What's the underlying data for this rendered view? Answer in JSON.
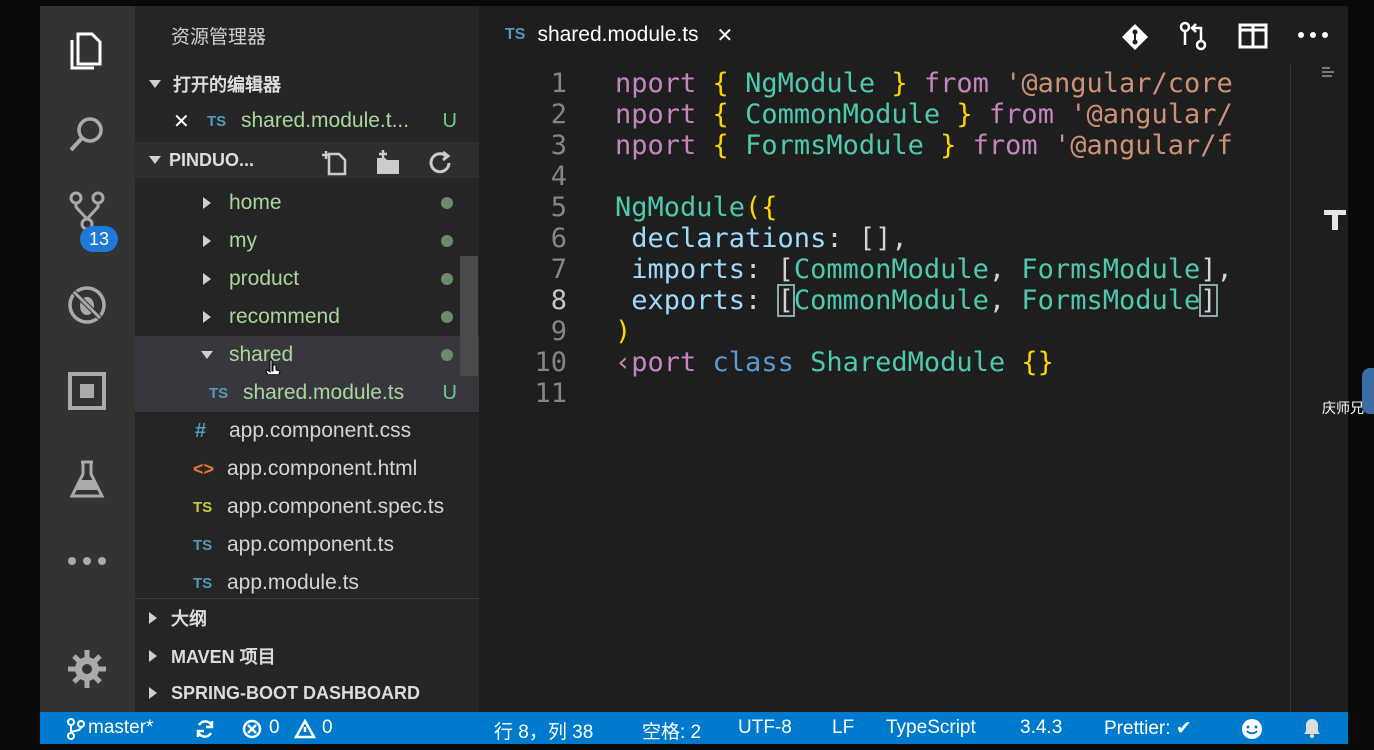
{
  "sidebar": {
    "title": "资源管理器",
    "open_editors_header": "打开的编辑器",
    "open_editor": {
      "badge": "TS",
      "name": "shared.module.t...",
      "status": "U"
    },
    "project_header": "PINDUO...",
    "tree": [
      {
        "name": "home",
        "type": "folder"
      },
      {
        "name": "my",
        "type": "folder"
      },
      {
        "name": "product",
        "type": "folder"
      },
      {
        "name": "recommend",
        "type": "folder"
      },
      {
        "name": "shared",
        "type": "folder-open"
      },
      {
        "name": "shared.module.ts",
        "badge": "TS",
        "status": "U"
      },
      {
        "name": "app.component.css",
        "badge": "#"
      },
      {
        "name": "app.component.html",
        "badge": "<>"
      },
      {
        "name": "app.component.spec.ts",
        "badge": "TS"
      },
      {
        "name": "app.component.ts",
        "badge": "TS"
      },
      {
        "name": "app.module.ts",
        "badge": "TS"
      }
    ],
    "outline_header": "大纲",
    "maven_header": "MAVEN 项目",
    "springboot_header": "SPRING-BOOT DASHBOARD"
  },
  "activity": {
    "scm_badge": "13"
  },
  "tab": {
    "badge": "TS",
    "label": "shared.module.ts",
    "close": "✕"
  },
  "editor": {
    "line_numbers": [
      "1",
      "2",
      "3",
      "4",
      "5",
      "6",
      "7",
      "8",
      "9",
      "10",
      "11"
    ],
    "lines": {
      "l1": {
        "a": "nport ",
        "b": "{ ",
        "c": "NgModule",
        "d": " } ",
        "e": "from ",
        "f": "'@angular/core"
      },
      "l2": {
        "a": "nport ",
        "b": "{ ",
        "c": "CommonModule",
        "d": " } ",
        "e": "from ",
        "f": "'@angular/"
      },
      "l3": {
        "a": "nport ",
        "b": "{ ",
        "c": "FormsModule",
        "d": " } ",
        "e": "from ",
        "f": "'@angular/f"
      },
      "l5": {
        "a": "NgModule",
        "b": "({"
      },
      "l6": {
        "a": " declarations",
        "b": ": [],"
      },
      "l7": {
        "a": " imports",
        "b": ": [",
        "c": "CommonModule",
        "d": ", ",
        "e": "FormsModule",
        "f": "],"
      },
      "l8": {
        "a": " exports",
        "b": ": ",
        "c": "[",
        "d": "CommonModule",
        "e": ", ",
        "f": "FormsModule",
        "g": "]"
      },
      "l9": {
        "a": ")"
      },
      "l10": {
        "a": "‹port ",
        "b": "class ",
        "c": "SharedModule",
        "d": " {}"
      }
    }
  },
  "status": {
    "branch": "master*",
    "errors": "0",
    "warnings": "0",
    "position": "行 8，列 38",
    "indent": "空格: 2",
    "encoding": "UTF-8",
    "eol": "LF",
    "language": "TypeScript",
    "version": "3.4.3",
    "prettier": "Prettier: ✔"
  },
  "overlay": {
    "side_label": "庆师兄"
  }
}
